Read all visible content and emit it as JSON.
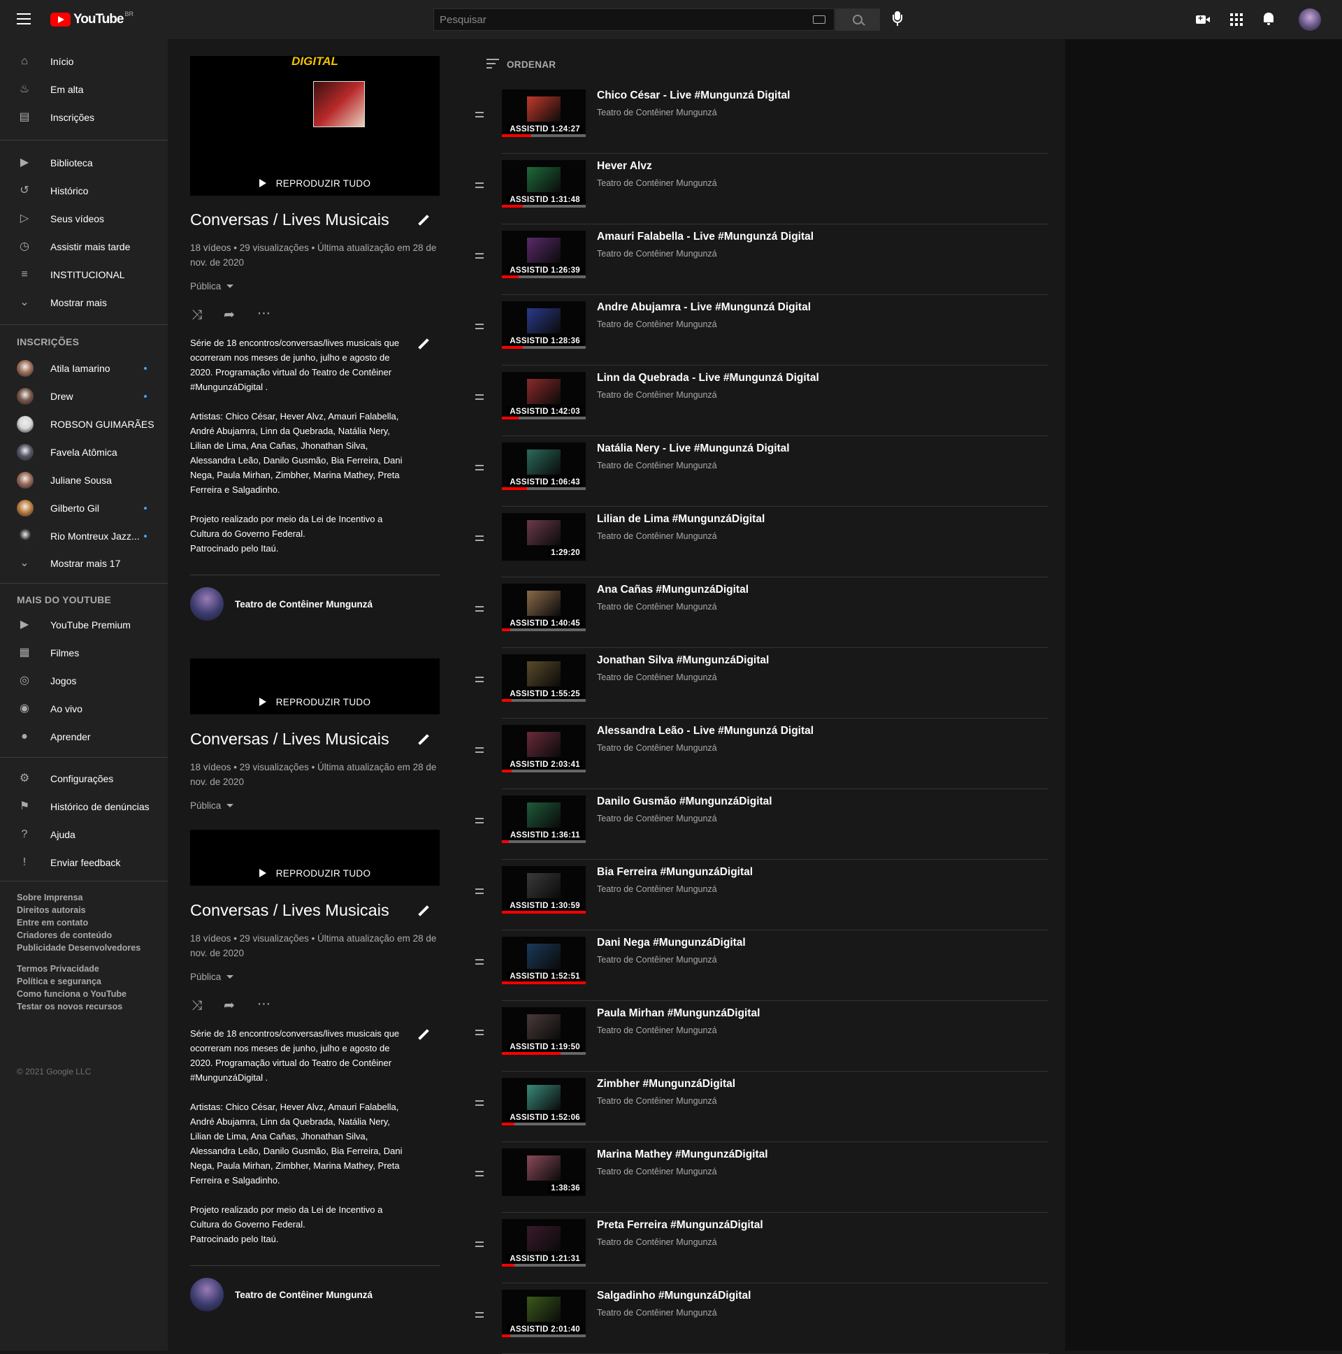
{
  "header": {
    "logo_word": "YouTube",
    "logo_country": "BR",
    "search_placeholder": "Pesquisar"
  },
  "sidebar": {
    "main": [
      {
        "label": "Início",
        "icon": "home-icon",
        "glyph": "⌂"
      },
      {
        "label": "Em alta",
        "icon": "trending-icon",
        "glyph": "♨"
      },
      {
        "label": "Inscrições",
        "icon": "subscriptions-icon",
        "glyph": "▤"
      }
    ],
    "library": [
      {
        "label": "Biblioteca",
        "icon": "library-icon",
        "glyph": "▶"
      },
      {
        "label": "Histórico",
        "icon": "history-icon",
        "glyph": "↺"
      },
      {
        "label": "Seus vídeos",
        "icon": "your-videos-icon",
        "glyph": "▷"
      },
      {
        "label": "Assistir mais tarde",
        "icon": "watch-later-icon",
        "glyph": "◷"
      },
      {
        "label": "INSTITUCIONAL",
        "icon": "playlist-icon",
        "glyph": "≡"
      },
      {
        "label": "Mostrar mais",
        "icon": "chevron-down-icon",
        "glyph": "⌄"
      }
    ],
    "subscriptions_heading": "INSCRIÇÕES",
    "subscriptions": [
      {
        "label": "Atila Iamarino",
        "dot": true,
        "color": "#a0705a"
      },
      {
        "label": "Drew",
        "dot": true,
        "color": "#7a5848"
      },
      {
        "label": "ROBSON GUIMARÃES",
        "dot": false,
        "color": "#d8d8d8"
      },
      {
        "label": "Favela Atômica",
        "dot": false,
        "color": "#555566"
      },
      {
        "label": "Juliane Sousa",
        "dot": false,
        "color": "#9a6a58"
      },
      {
        "label": "Gilberto Gil",
        "dot": true,
        "color": "#c08040"
      },
      {
        "label": "Rio Montreux Jazz...",
        "dot": true,
        "color": "#222222"
      }
    ],
    "show_more_subs": "Mostrar mais 17",
    "more_heading": "MAIS DO YOUTUBE",
    "more": [
      {
        "label": "YouTube Premium",
        "icon": "youtube-premium-icon",
        "glyph": "▶"
      },
      {
        "label": "Filmes",
        "icon": "movies-icon",
        "glyph": "▦"
      },
      {
        "label": "Jogos",
        "icon": "gaming-icon",
        "glyph": "◎"
      },
      {
        "label": "Ao vivo",
        "icon": "live-icon",
        "glyph": "◉"
      },
      {
        "label": "Aprender",
        "icon": "learning-icon",
        "glyph": "●"
      }
    ],
    "settings": [
      {
        "label": "Configurações",
        "icon": "gear-icon",
        "glyph": "⚙"
      },
      {
        "label": "Histórico de denúncias",
        "icon": "flag-icon",
        "glyph": "⚑"
      },
      {
        "label": "Ajuda",
        "icon": "help-icon",
        "glyph": "?"
      },
      {
        "label": "Enviar feedback",
        "icon": "feedback-icon",
        "glyph": "!"
      }
    ],
    "footer1": [
      "Sobre  Imprensa",
      "Direitos autorais",
      "Entre em contato",
      "Criadores de conteúdo",
      "Publicidade  Desenvolvedores"
    ],
    "footer2": [
      "Termos  Privacidade",
      "Política e segurança",
      "Como funciona o YouTube",
      "Testar os novos recursos"
    ],
    "copyright": "© 2021 Google LLC"
  },
  "playlist": {
    "thumb_brand": "DIGITAL",
    "play_all": "REPRODUZIR TUDO",
    "title": "Conversas / Lives Musicais",
    "stats": "18 vídeos • 29 visualizações • Última atualização em 28 de nov. de 2020",
    "privacy": "Pública",
    "description": "Série de 18 encontros/conversas/lives musicais que ocorreram nos meses de junho, julho e agosto de 2020. Programação virtual do Teatro de Contêiner #MungunzáDigital .\n\nArtistas: Chico César, Hever Alvz, Amauri Falabella, André Abujamra, Linn da Quebrada, Natália Nery, Lilian de Lima, Ana Cañas, Jhonathan Silva, Alessandra Leão, Danilo Gusmão, Bia Ferreira, Dani Nega, Paula Mirhan, Zimbher, Marina Mathey, Preta Ferreira e Salgadinho.\n\nProjeto realizado por meio da Lei de Incentivo a Cultura do Governo Federal.\nPatrocinado pelo Itaú.",
    "owner": "Teatro de Contêiner Mungunzá"
  },
  "list": {
    "sort_label": "ORDENAR",
    "videos": [
      {
        "title": "Chico César - Live #Mungunzá Digital",
        "channel": "Teatro de Contêiner Mungunzá",
        "badge": "ASSISTID 1:24:27",
        "progress": 0.35,
        "art": "#c23a2a"
      },
      {
        "title": "Hever Alvz",
        "channel": "Teatro de Contêiner Mungunzá",
        "badge": "ASSISTID 1:31:48",
        "progress": 0.25,
        "art": "#1e6a3a"
      },
      {
        "title": "Amauri Falabella - Live #Mungunzá Digital",
        "channel": "Teatro de Contêiner Mungunzá",
        "badge": "ASSISTID 1:26:39",
        "progress": 0.2,
        "art": "#5a2a6a"
      },
      {
        "title": "Andre Abujamra - Live #Mungunzá Digital",
        "channel": "Teatro de Contêiner Mungunzá",
        "badge": "ASSISTID 1:28:36",
        "progress": 0.25,
        "art": "#2a3a8a"
      },
      {
        "title": "Linn da Quebrada - Live #Mungunzá Digital",
        "channel": "Teatro de Contêiner Mungunzá",
        "badge": "ASSISTID 1:42:03",
        "progress": 0.2,
        "art": "#8a2a2a"
      },
      {
        "title": "Natália Nery - Live #Mungunzá Digital",
        "channel": "Teatro de Contêiner Mungunzá",
        "badge": "ASSISTID 1:06:43",
        "progress": 0.3,
        "art": "#2a6a5a"
      },
      {
        "title": "Lilian de Lima #MungunzáDigital",
        "channel": "Teatro de Contêiner Mungunzá",
        "badge": "1:29:20",
        "progress": 0,
        "art": "#6a3a4a"
      },
      {
        "title": "Ana Cañas #MungunzáDigital",
        "channel": "Teatro de Contêiner Mungunzá",
        "badge": "ASSISTID 1:40:45",
        "progress": 0.1,
        "art": "#8a6a4a"
      },
      {
        "title": "Jonathan Silva #MungunzáDigital",
        "channel": "Teatro de Contêiner Mungunzá",
        "badge": "ASSISTID 1:55:25",
        "progress": 0.12,
        "art": "#5a4a2a"
      },
      {
        "title": "Alessandra Leão - Live #Mungunzá Digital",
        "channel": "Teatro de Contêiner Mungunzá",
        "badge": "ASSISTID 2:03:41",
        "progress": 0.12,
        "art": "#6a2a3a"
      },
      {
        "title": "Danilo Gusmão #MungunzáDigital",
        "channel": "Teatro de Contêiner Mungunzá",
        "badge": "ASSISTID 1:36:11",
        "progress": 0.08,
        "art": "#1e5a3a"
      },
      {
        "title": "Bia Ferreira #MungunzáDigital",
        "channel": "Teatro de Contêiner Mungunzá",
        "badge": "ASSISTID 1:30:59",
        "progress": 1.0,
        "art": "#3a3a3a"
      },
      {
        "title": "Dani Nega #MungunzáDigital",
        "channel": "Teatro de Contêiner Mungunzá",
        "badge": "ASSISTID 1:52:51",
        "progress": 1.0,
        "art": "#1a3a5a"
      },
      {
        "title": "Paula Mirhan #MungunzáDigital",
        "channel": "Teatro de Contêiner Mungunzá",
        "badge": "ASSISTID 1:19:50",
        "progress": 0.7,
        "art": "#4a3a3a"
      },
      {
        "title": "Zimbher #MungunzáDigital",
        "channel": "Teatro de Contêiner Mungunzá",
        "badge": "ASSISTID 1:52:06",
        "progress": 0.15,
        "art": "#3a8a7a"
      },
      {
        "title": "Marina Mathey #MungunzáDigital",
        "channel": "Teatro de Contêiner Mungunzá",
        "badge": "1:38:36",
        "progress": 0,
        "art": "#8a4a5a"
      },
      {
        "title": "Preta Ferreira #MungunzáDigital",
        "channel": "Teatro de Contêiner Mungunzá",
        "badge": "ASSISTID 1:21:31",
        "progress": 0.15,
        "art": "#3a1a2a"
      },
      {
        "title": "Salgadinho #MungunzáDigital",
        "channel": "Teatro de Contêiner Mungunzá",
        "badge": "ASSISTID 2:01:40",
        "progress": 0.1,
        "art": "#3a5a1a"
      }
    ]
  }
}
